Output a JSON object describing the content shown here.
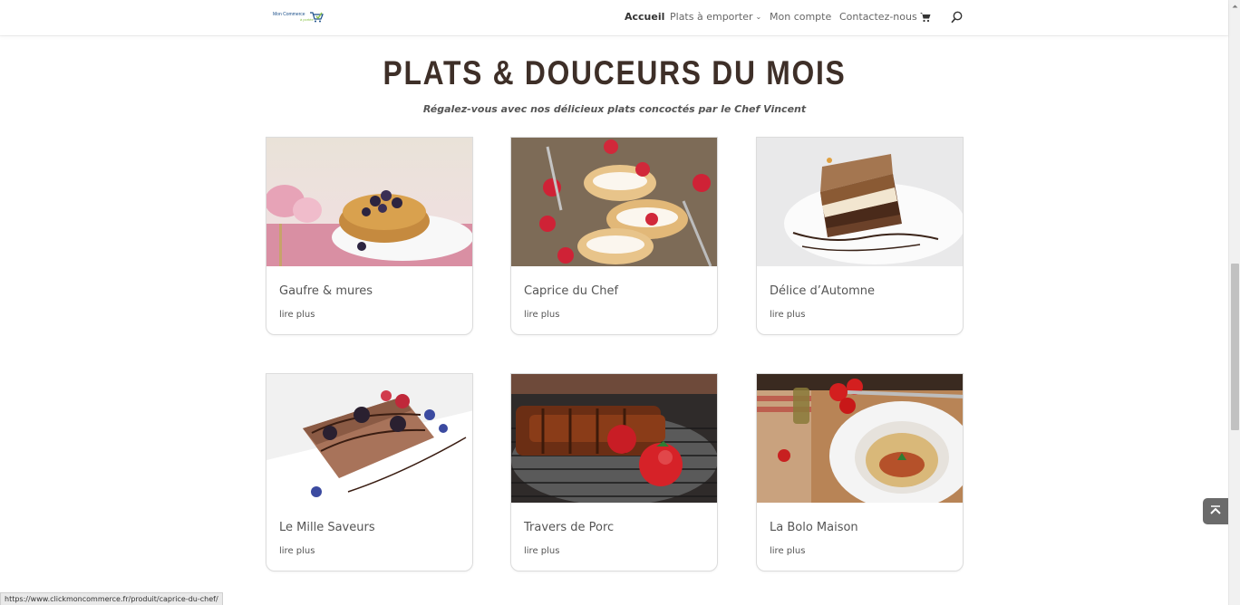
{
  "header": {
    "logo_text": "Mon Commerce",
    "logo_sub": "à portée",
    "nav": [
      {
        "label": "Accueil"
      },
      {
        "label": "Plats à emporter"
      },
      {
        "label": "Mon compte"
      },
      {
        "label": "Contactez-nous"
      }
    ],
    "icons": [
      "cart-icon",
      "search-icon"
    ]
  },
  "main": {
    "title": "PLATS & DOUCEURS DU MOIS",
    "subtitle": "Régalez-vous avec nos délicieux plats concoctés par le Chef Vincent",
    "read_more": "lire plus",
    "products": [
      {
        "name": "Gaufre & mures"
      },
      {
        "name": "Caprice du Chef"
      },
      {
        "name": "Délice d’Automne"
      },
      {
        "name": "Le Mille Saveurs"
      },
      {
        "name": "Travers de Porc"
      },
      {
        "name": "La Bolo Maison"
      }
    ]
  },
  "status_bar": {
    "url": "https://www.clickmoncommerce.fr/produit/caprice-du-chef/"
  },
  "colors": {
    "title": "#3e2f28",
    "text": "#666666",
    "back_to_top": "#6b6b6b"
  }
}
